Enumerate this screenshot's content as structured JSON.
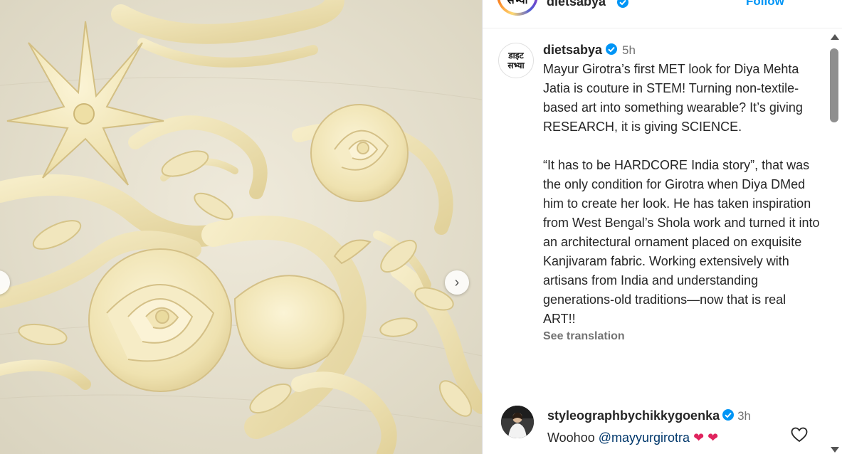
{
  "colors": {
    "link": "#0095f6",
    "verified": "#0095f6",
    "mention": "#00376b",
    "muted": "#737373",
    "text": "#262626"
  },
  "header": {
    "avatar_text": "सभ्या",
    "username": "dietsabya",
    "follow_label": "Follow"
  },
  "caption": {
    "avatar_line1": "डाइट",
    "avatar_line2": "सभ्या",
    "username": "dietsabya",
    "time": "5h",
    "text": "Mayur Girotra’s first MET look for Diya Mehta Jatia is couture in STEM! Turning non-textile-based art into something wearable? It’s giving RESEARCH, it is giving SCIENCE.\n\n“It has to be HARDCORE India story”, that was the only condition for Girotra when Diya DMed him to create her look. He has taken inspiration from West Bengal’s Shola work and turned it into an architectural ornament placed on exquisite Kanjivaram fabric. Working extensively with artisans from India and understanding generations-old traditions—now that is real ART!!",
    "see_translation": "See translation"
  },
  "comment": {
    "username": "styleographbychikkygoenka",
    "time": "3h",
    "text": "Woohoo",
    "mention": "@mayyurgirotra",
    "emojis": "❤ ❤"
  },
  "icons": {
    "next": "chevron-right-icon",
    "prev": "chevron-left-icon",
    "like": "heart-outline-icon",
    "verified": "verified-badge-icon"
  }
}
